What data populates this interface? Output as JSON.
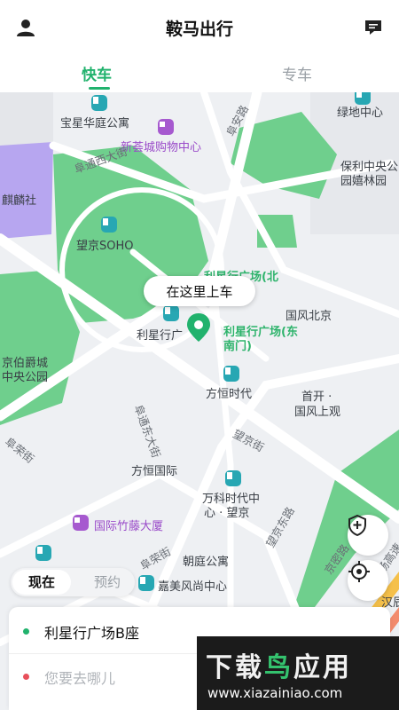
{
  "header": {
    "title": "鞍马出行",
    "user_icon": "person-icon",
    "message_icon": "chat-icon"
  },
  "tabs": [
    {
      "label": "快车",
      "active": true
    },
    {
      "label": "专车",
      "active": false
    }
  ],
  "colors": {
    "accent": "#21b26d",
    "park_green": "#6fcf8d",
    "road": "#ffffff",
    "map_bg": "#eef0f3"
  },
  "map": {
    "labels": {
      "baoxing": "宝星华庭公寓",
      "xinhuicheng": "新荟城购物中心",
      "futong_west": "阜通西大街",
      "fuan_road": "阜安路",
      "lvdi": "绿地中心",
      "baoli_1": "保利中央公",
      "baoli_2": "园嬉林园",
      "qilin": "麒麟社",
      "wangjing_soho": "望京SOHO",
      "lixing_north": "利星行广场(北",
      "lixing_short": "利星行广",
      "lixing_east_1": "利星行广场(东",
      "lixing_east_2": "南门)",
      "guofeng_beijing": "国风北京",
      "bojue_1": "京伯爵城",
      "bojue_2": "中央公园",
      "fangheng_time": "方恒时代",
      "shoukai_1": "首开 ·",
      "shoukai_2": "国风上观",
      "futong_east": "阜通东大街",
      "wangjing_street": "望京街",
      "fuyong_street": "阜荣街",
      "fangheng_intl": "方恒国际",
      "wanke_1": "万科时代中",
      "wanke_2": "心 · 望京",
      "intl_bamboo": "国际竹藤大厦",
      "wangjing_east": "望京东路",
      "jingmi": "京密路",
      "airport_exp": "机场高速",
      "fuyong_street_2": "阜荣街",
      "chaoting": "朝庭公寓",
      "jiamei": "嘉美风尚中心",
      "hanfeng": "汉辰"
    },
    "pickup_bubble": "在这里上车",
    "pin_icon": "map-pin-icon",
    "shield_icon": "shield-plus-icon",
    "locate_icon": "locate-icon"
  },
  "time_toggle": {
    "now": "现在",
    "reserve": "预约"
  },
  "trip": {
    "origin": "利星行广场B座",
    "destination_placeholder": "您要去哪儿"
  },
  "watermark": {
    "title_part1": "下载",
    "title_part2": "鸟",
    "title_part3": "应用",
    "url": "www.xiazainiao.com"
  }
}
